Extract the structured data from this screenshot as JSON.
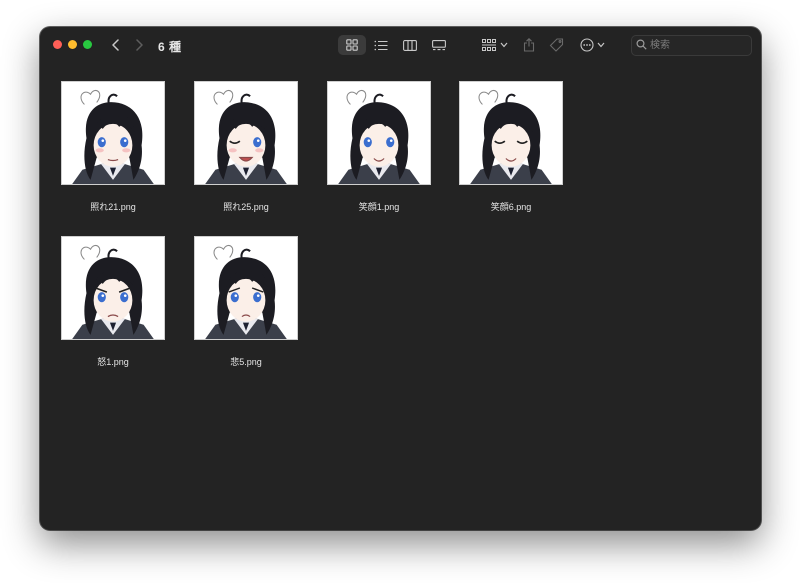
{
  "window": {
    "title": "6 種"
  },
  "toolbar": {
    "views": [
      "icon-view",
      "list-view",
      "column-view",
      "gallery-view"
    ],
    "active_view": "icon-view"
  },
  "search": {
    "placeholder": "検索",
    "value": ""
  },
  "files": [
    {
      "name": "照れ21.png",
      "expression": "shy"
    },
    {
      "name": "照れ25.png",
      "expression": "grin"
    },
    {
      "name": "笑顔1.png",
      "expression": "smile"
    },
    {
      "name": "笑顔6.png",
      "expression": "closed-eye-smile"
    },
    {
      "name": "怒1.png",
      "expression": "angry"
    },
    {
      "name": "悲5.png",
      "expression": "sad"
    }
  ],
  "colors": {
    "window_bg": "#232323",
    "close": "#fe5f57",
    "minimize": "#febc2e",
    "zoom": "#28c840",
    "hair": "#1c1c22",
    "eyes": "#3b6ecf"
  }
}
